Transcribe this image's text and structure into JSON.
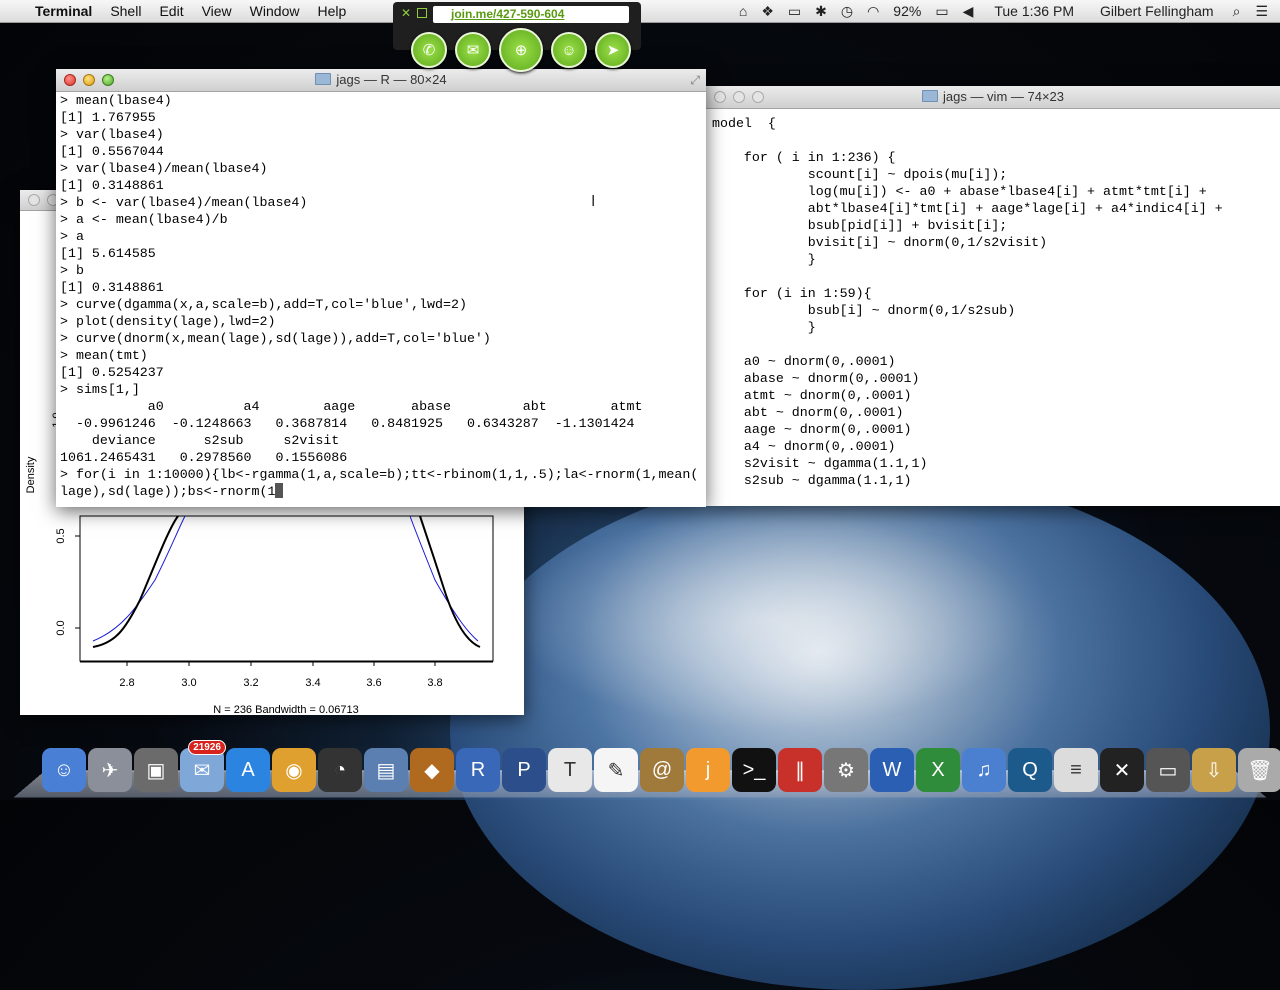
{
  "menubar": {
    "app_name": "Terminal",
    "items": [
      "Shell",
      "Edit",
      "View",
      "Window",
      "Help"
    ],
    "battery": "92%",
    "clock": "Tue 1:36 PM",
    "user": "Gilbert Fellingham"
  },
  "joinme": {
    "url": "join.me/427-590-604"
  },
  "r_window": {
    "title": "jags — R — 80×24",
    "lines": [
      "> mean(lbase4)",
      "[1] 1.767955",
      "> var(lbase4)",
      "[1] 0.5567044",
      "> var(lbase4)/mean(lbase4)",
      "[1] 0.3148861",
      "> b <- var(lbase4)/mean(lbase4)",
      "> a <- mean(lbase4)/b",
      "> a",
      "[1] 5.614585",
      "> b",
      "[1] 0.3148861",
      "> curve(dgamma(x,a,scale=b),add=T,col='blue',lwd=2)",
      "> plot(density(lage),lwd=2)",
      "> curve(dnorm(x,mean(lage),sd(lage)),add=T,col='blue')",
      "> mean(tmt)",
      "[1] 0.5254237",
      "> sims[1,]",
      "           a0          a4        aage       abase         abt        atmt",
      "  -0.9961246  -0.1248663   0.3687814   0.8481925   0.6343287  -1.1301424",
      "    deviance      s2sub     s2visit",
      "1061.2465431   0.2978560   0.1556086",
      "> for(i in 1:10000){lb<-rgamma(1,a,scale=b);tt<-rbinom(1,1,.5);la<-rnorm(1,mean(",
      "lage),sd(lage));bs<-rnorm(1"
    ]
  },
  "vim_window": {
    "title": "jags — vim — 74×23",
    "lines": [
      "model  {",
      "",
      "    for ( i in 1:236) {",
      "            scount[i] ~ dpois(mu[i]);",
      "            log(mu[i]) <- a0 + abase*lbase4[i] + atmt*tmt[i] +",
      "            abt*lbase4[i]*tmt[i] + aage*lage[i] + a4*indic4[i] +",
      "            bsub[pid[i]] + bvisit[i];",
      "            bvisit[i] ~ dnorm(0,1/s2visit)",
      "            }",
      "",
      "    for (i in 1:59){",
      "            bsub[i] ~ dnorm(0,1/s2sub)",
      "            }",
      "",
      "    a0 ~ dnorm(0,.0001)",
      "    abase ~ dnorm(0,.0001)",
      "    atmt ~ dnorm(0,.0001)",
      "    abt ~ dnorm(0,.0001)",
      "    aage ~ dnorm(0,.0001)",
      "    a4 ~ dnorm(0,.0001)",
      "    s2visit ~ dgamma(1.1,1)",
      "    s2sub ~ dgamma(1.1,1)"
    ]
  },
  "plot_window": {
    "ylabel": "Density",
    "yticks": [
      "0.0",
      "0.5"
    ],
    "xticks": [
      "2.8",
      "3.0",
      "3.2",
      "3.4",
      "3.6",
      "3.8"
    ],
    "xlabel": "N = 236   Bandwidth = 0.06713",
    "partial_ytick": "1.0"
  },
  "dock": {
    "mail_badge": "21926",
    "items": [
      "Finder",
      "Launchpad",
      "Photo Booth",
      "Mail",
      "App Store",
      "Chrome",
      "Dashboard",
      "Preview",
      "Growl",
      "R",
      "Pandora",
      "LaTeX",
      "TextEdit",
      "Address Book",
      "join.me",
      "Terminal",
      "Parallels",
      "System Preferences",
      "Word",
      "Excel",
      "iTunes",
      "QuickTime",
      "Plist",
      "X11",
      "Terminal Window",
      "Downloads",
      "Trash"
    ]
  }
}
